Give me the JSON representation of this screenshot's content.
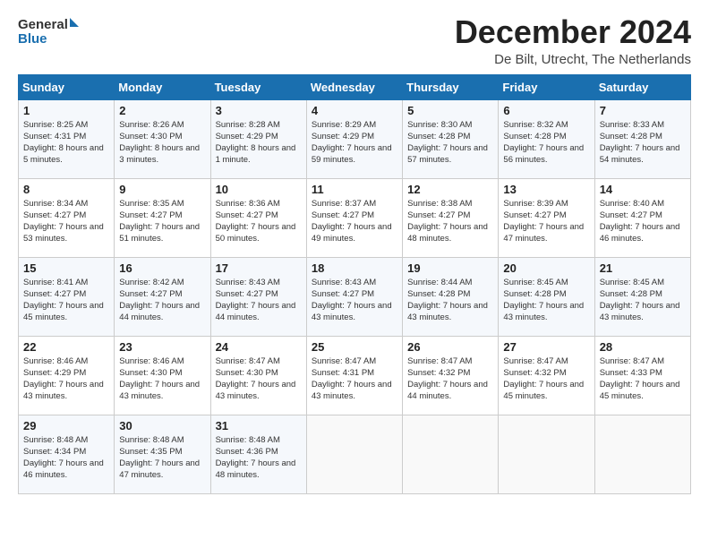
{
  "logo": {
    "line1": "General",
    "line2": "Blue"
  },
  "title": "December 2024",
  "subtitle": "De Bilt, Utrecht, The Netherlands",
  "days_of_week": [
    "Sunday",
    "Monday",
    "Tuesday",
    "Wednesday",
    "Thursday",
    "Friday",
    "Saturday"
  ],
  "weeks": [
    [
      {
        "day": 1,
        "sunrise": "8:25 AM",
        "sunset": "4:31 PM",
        "daylight": "8 hours and 5 minutes."
      },
      {
        "day": 2,
        "sunrise": "8:26 AM",
        "sunset": "4:30 PM",
        "daylight": "8 hours and 3 minutes."
      },
      {
        "day": 3,
        "sunrise": "8:28 AM",
        "sunset": "4:29 PM",
        "daylight": "8 hours and 1 minute."
      },
      {
        "day": 4,
        "sunrise": "8:29 AM",
        "sunset": "4:29 PM",
        "daylight": "7 hours and 59 minutes."
      },
      {
        "day": 5,
        "sunrise": "8:30 AM",
        "sunset": "4:28 PM",
        "daylight": "7 hours and 57 minutes."
      },
      {
        "day": 6,
        "sunrise": "8:32 AM",
        "sunset": "4:28 PM",
        "daylight": "7 hours and 56 minutes."
      },
      {
        "day": 7,
        "sunrise": "8:33 AM",
        "sunset": "4:28 PM",
        "daylight": "7 hours and 54 minutes."
      }
    ],
    [
      {
        "day": 8,
        "sunrise": "8:34 AM",
        "sunset": "4:27 PM",
        "daylight": "7 hours and 53 minutes."
      },
      {
        "day": 9,
        "sunrise": "8:35 AM",
        "sunset": "4:27 PM",
        "daylight": "7 hours and 51 minutes."
      },
      {
        "day": 10,
        "sunrise": "8:36 AM",
        "sunset": "4:27 PM",
        "daylight": "7 hours and 50 minutes."
      },
      {
        "day": 11,
        "sunrise": "8:37 AM",
        "sunset": "4:27 PM",
        "daylight": "7 hours and 49 minutes."
      },
      {
        "day": 12,
        "sunrise": "8:38 AM",
        "sunset": "4:27 PM",
        "daylight": "7 hours and 48 minutes."
      },
      {
        "day": 13,
        "sunrise": "8:39 AM",
        "sunset": "4:27 PM",
        "daylight": "7 hours and 47 minutes."
      },
      {
        "day": 14,
        "sunrise": "8:40 AM",
        "sunset": "4:27 PM",
        "daylight": "7 hours and 46 minutes."
      }
    ],
    [
      {
        "day": 15,
        "sunrise": "8:41 AM",
        "sunset": "4:27 PM",
        "daylight": "7 hours and 45 minutes."
      },
      {
        "day": 16,
        "sunrise": "8:42 AM",
        "sunset": "4:27 PM",
        "daylight": "7 hours and 44 minutes."
      },
      {
        "day": 17,
        "sunrise": "8:43 AM",
        "sunset": "4:27 PM",
        "daylight": "7 hours and 44 minutes."
      },
      {
        "day": 18,
        "sunrise": "8:43 AM",
        "sunset": "4:27 PM",
        "daylight": "7 hours and 43 minutes."
      },
      {
        "day": 19,
        "sunrise": "8:44 AM",
        "sunset": "4:28 PM",
        "daylight": "7 hours and 43 minutes."
      },
      {
        "day": 20,
        "sunrise": "8:45 AM",
        "sunset": "4:28 PM",
        "daylight": "7 hours and 43 minutes."
      },
      {
        "day": 21,
        "sunrise": "8:45 AM",
        "sunset": "4:28 PM",
        "daylight": "7 hours and 43 minutes."
      }
    ],
    [
      {
        "day": 22,
        "sunrise": "8:46 AM",
        "sunset": "4:29 PM",
        "daylight": "7 hours and 43 minutes."
      },
      {
        "day": 23,
        "sunrise": "8:46 AM",
        "sunset": "4:30 PM",
        "daylight": "7 hours and 43 minutes."
      },
      {
        "day": 24,
        "sunrise": "8:47 AM",
        "sunset": "4:30 PM",
        "daylight": "7 hours and 43 minutes."
      },
      {
        "day": 25,
        "sunrise": "8:47 AM",
        "sunset": "4:31 PM",
        "daylight": "7 hours and 43 minutes."
      },
      {
        "day": 26,
        "sunrise": "8:47 AM",
        "sunset": "4:32 PM",
        "daylight": "7 hours and 44 minutes."
      },
      {
        "day": 27,
        "sunrise": "8:47 AM",
        "sunset": "4:32 PM",
        "daylight": "7 hours and 45 minutes."
      },
      {
        "day": 28,
        "sunrise": "8:47 AM",
        "sunset": "4:33 PM",
        "daylight": "7 hours and 45 minutes."
      }
    ],
    [
      {
        "day": 29,
        "sunrise": "8:48 AM",
        "sunset": "4:34 PM",
        "daylight": "7 hours and 46 minutes."
      },
      {
        "day": 30,
        "sunrise": "8:48 AM",
        "sunset": "4:35 PM",
        "daylight": "7 hours and 47 minutes."
      },
      {
        "day": 31,
        "sunrise": "8:48 AM",
        "sunset": "4:36 PM",
        "daylight": "7 hours and 48 minutes."
      },
      null,
      null,
      null,
      null
    ]
  ]
}
